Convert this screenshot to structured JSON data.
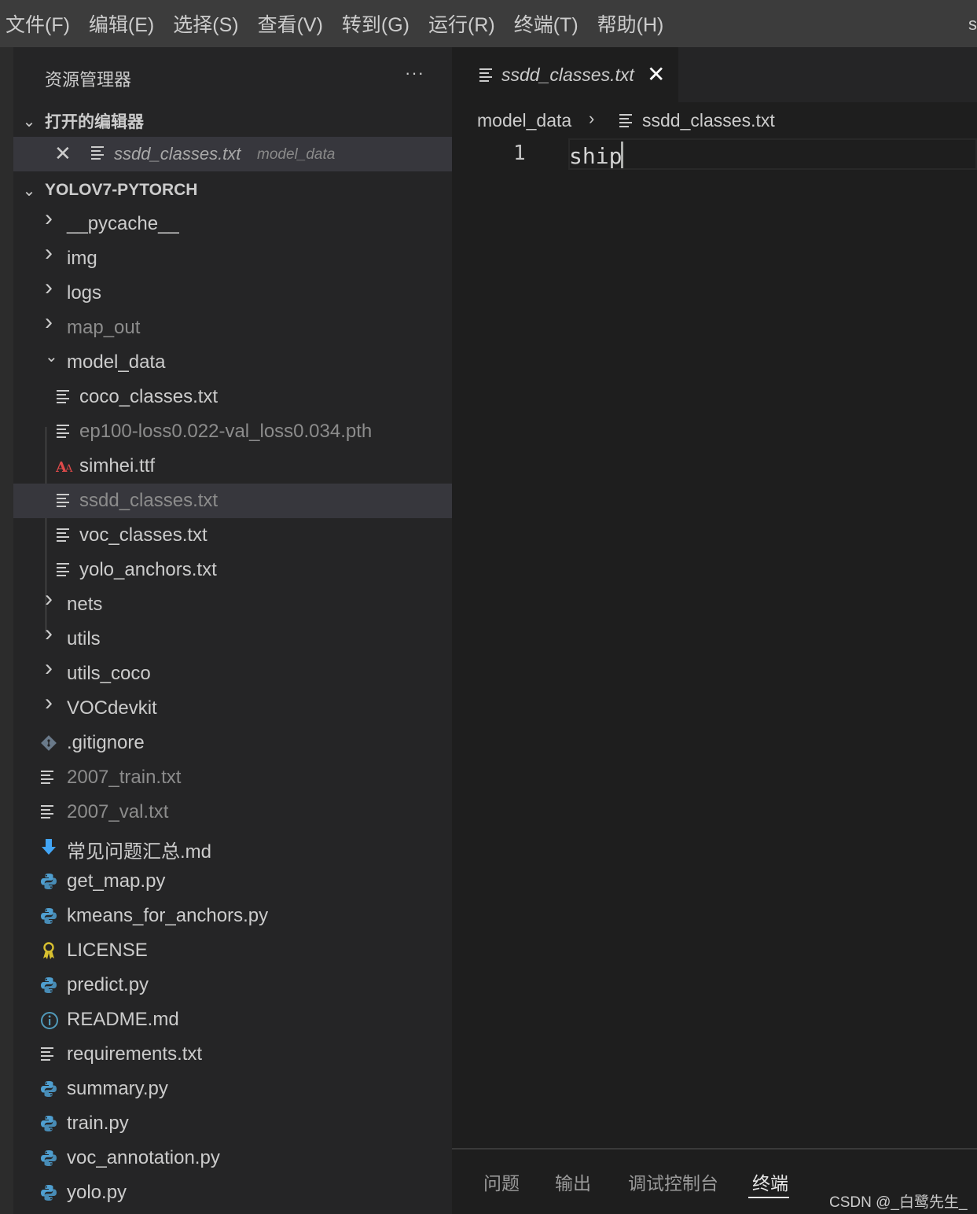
{
  "menubar": {
    "items": [
      "文件(F)",
      "编辑(E)",
      "选择(S)",
      "查看(V)",
      "转到(G)",
      "运行(R)",
      "终端(T)",
      "帮助(H)"
    ],
    "overflow": "s"
  },
  "sidebar": {
    "title": "资源管理器",
    "more": "···",
    "open_editors": {
      "label": "打开的编辑器",
      "file": "ssdd_classes.txt",
      "path": "model_data"
    },
    "project": {
      "label": "YOLOV7-PYTORCH",
      "items": [
        {
          "name": "__pycache__",
          "type": "folder",
          "state": "collapsed",
          "style": "normal"
        },
        {
          "name": "img",
          "type": "folder",
          "state": "collapsed",
          "style": "normal"
        },
        {
          "name": "logs",
          "type": "folder",
          "state": "collapsed",
          "style": "normal"
        },
        {
          "name": "map_out",
          "type": "folder",
          "state": "collapsed",
          "style": "dim"
        },
        {
          "name": "model_data",
          "type": "folder",
          "state": "expanded",
          "style": "normal"
        },
        {
          "name": "coco_classes.txt",
          "type": "text",
          "style": "normal",
          "depth": 2
        },
        {
          "name": "ep100-loss0.022-val_loss0.034.pth",
          "type": "text",
          "style": "dim",
          "depth": 2
        },
        {
          "name": "simhei.ttf",
          "type": "font",
          "style": "normal",
          "depth": 2
        },
        {
          "name": "ssdd_classes.txt",
          "type": "text",
          "style": "dim",
          "depth": 2,
          "selected": true
        },
        {
          "name": "voc_classes.txt",
          "type": "text",
          "style": "normal",
          "depth": 2
        },
        {
          "name": "yolo_anchors.txt",
          "type": "text",
          "style": "normal",
          "depth": 2
        },
        {
          "name": "nets",
          "type": "folder",
          "state": "collapsed",
          "style": "normal"
        },
        {
          "name": "utils",
          "type": "folder",
          "state": "collapsed",
          "style": "normal"
        },
        {
          "name": "utils_coco",
          "type": "folder",
          "state": "collapsed",
          "style": "normal"
        },
        {
          "name": "VOCdevkit",
          "type": "folder",
          "state": "collapsed",
          "style": "normal"
        },
        {
          "name": ".gitignore",
          "type": "git",
          "style": "normal"
        },
        {
          "name": "2007_train.txt",
          "type": "text",
          "style": "dim"
        },
        {
          "name": "2007_val.txt",
          "type": "text",
          "style": "dim"
        },
        {
          "name": "常见问题汇总.md",
          "type": "markdown",
          "style": "normal"
        },
        {
          "name": "get_map.py",
          "type": "python",
          "style": "normal"
        },
        {
          "name": "kmeans_for_anchors.py",
          "type": "python",
          "style": "normal"
        },
        {
          "name": "LICENSE",
          "type": "license",
          "style": "normal"
        },
        {
          "name": "predict.py",
          "type": "python",
          "style": "normal"
        },
        {
          "name": "README.md",
          "type": "info",
          "style": "normal"
        },
        {
          "name": "requirements.txt",
          "type": "text",
          "style": "normal"
        },
        {
          "name": "summary.py",
          "type": "python",
          "style": "normal"
        },
        {
          "name": "train.py",
          "type": "python",
          "style": "normal"
        },
        {
          "name": "voc_annotation.py",
          "type": "python",
          "style": "normal"
        },
        {
          "name": "yolo.py",
          "type": "python",
          "style": "normal"
        }
      ]
    }
  },
  "editor": {
    "tab_label": "ssdd_classes.txt",
    "breadcrumb": [
      "model_data",
      "ssdd_classes.txt"
    ],
    "lines": [
      {
        "num": "1",
        "text": "ship"
      }
    ]
  },
  "panel": {
    "tabs": [
      "问题",
      "输出",
      "调试控制台",
      "终端"
    ],
    "active": "终端",
    "watermark": "CSDN @_白鹭先生_"
  },
  "colors": {
    "python_icon": "#4f9fd0",
    "font_icon": "#e04a4a",
    "git_icon": "#6a7a8a",
    "license_icon": "#d8c030",
    "info_icon": "#519aba",
    "markdown_icon": "#42a5f5"
  }
}
